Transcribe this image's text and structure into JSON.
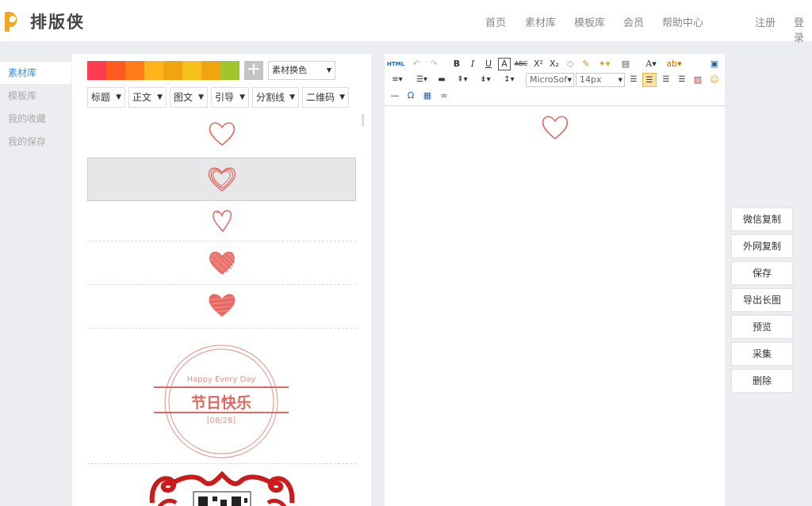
{
  "app": {
    "name": "排版侠"
  },
  "nav": {
    "home": "首页",
    "materials": "素材库",
    "templates": "模板库",
    "member": "会员",
    "help": "帮助中心",
    "register": "注册",
    "login": "登录"
  },
  "sidebar": {
    "items": [
      {
        "label": "素材库",
        "active": true
      },
      {
        "label": "模板库",
        "active": false
      },
      {
        "label": "我的收藏",
        "active": false
      },
      {
        "label": "我的保存",
        "active": false
      }
    ]
  },
  "palette": {
    "colors": [
      "#ff3b52",
      "#ff5a1f",
      "#ff7a1a",
      "#ffb21a",
      "#f2a312",
      "#f5c018",
      "#f0a510",
      "#a3c52c"
    ],
    "recolor_label": "素材换色"
  },
  "categories": [
    "标题",
    "正文",
    "图文",
    "引导",
    "分割线",
    "二维码"
  ],
  "materials": {
    "banner_en": "Happy Every Day",
    "banner_cn": "节日快乐",
    "banner_date": "[08/28]"
  },
  "editor": {
    "html_label": "HTML",
    "font_family": "MicroSof",
    "font_size": "14px",
    "symbol_omega": "Ω"
  },
  "actions": [
    "微信复制",
    "外网复制",
    "保存",
    "导出长图",
    "预览",
    "采集",
    "删除"
  ],
  "colors": {
    "accent": "#3b8fd9",
    "heart": "#e06860"
  }
}
